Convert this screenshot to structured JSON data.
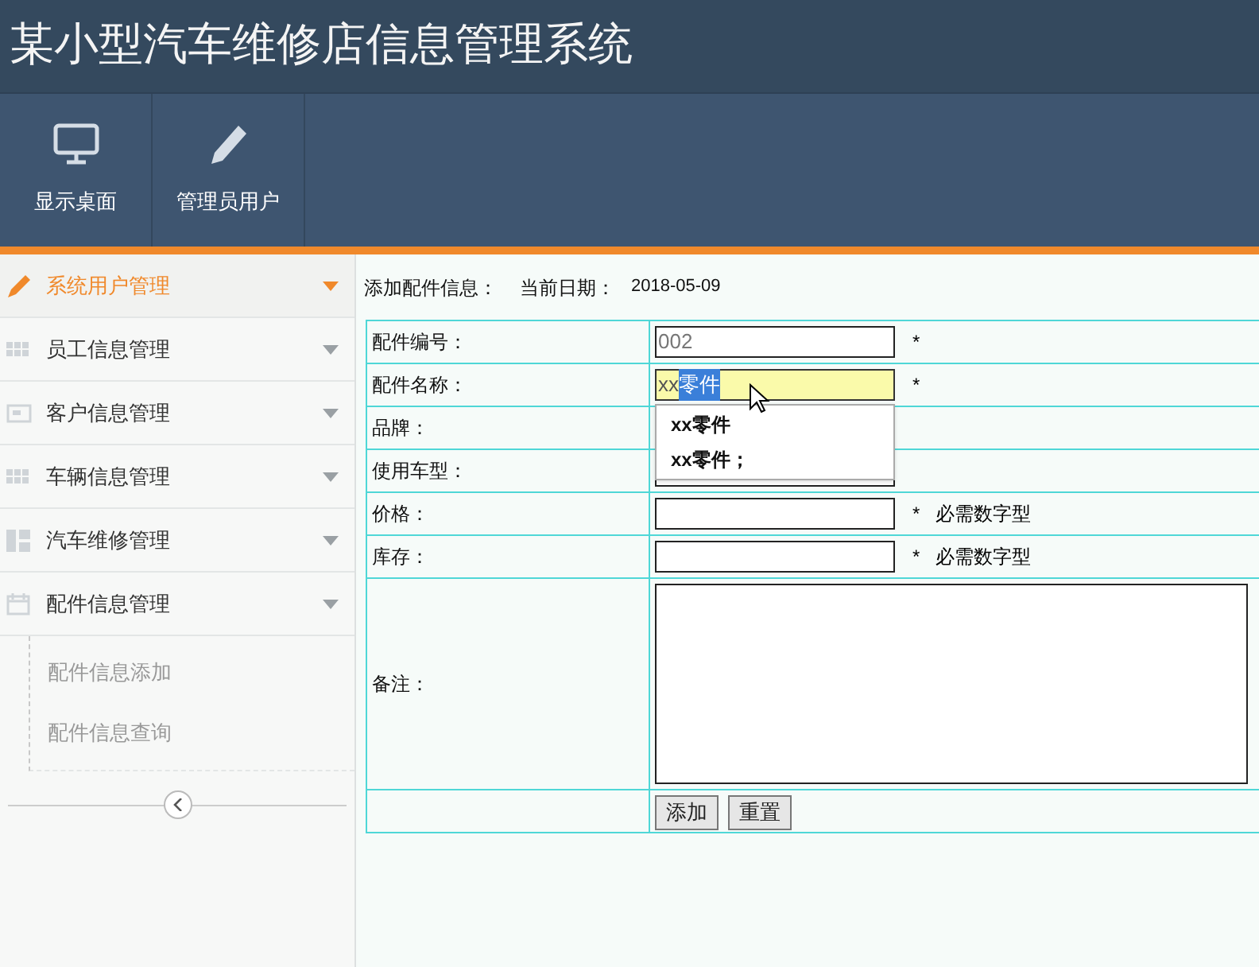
{
  "header": {
    "title": "某小型汽车维修店信息管理系统"
  },
  "toolbar": [
    {
      "label": "显示桌面"
    },
    {
      "label": "管理员用户"
    }
  ],
  "sidebar": {
    "items": [
      {
        "label": "系统用户管理",
        "selected": true
      },
      {
        "label": "员工信息管理",
        "selected": false
      },
      {
        "label": "客户信息管理",
        "selected": false
      },
      {
        "label": "车辆信息管理",
        "selected": false
      },
      {
        "label": "汽车维修管理",
        "selected": false
      },
      {
        "label": "配件信息管理",
        "selected": false,
        "children": [
          {
            "label": "配件信息添加"
          },
          {
            "label": "配件信息查询"
          }
        ]
      }
    ]
  },
  "page": {
    "heading": "添加配件信息：",
    "date_label": "当前日期：",
    "date": "2018-05-09"
  },
  "form": {
    "rows": [
      {
        "kind": "input",
        "label": "配件编号：",
        "value": "002",
        "required": "*"
      },
      {
        "kind": "input",
        "label": "配件名称：",
        "value": "xx",
        "selection": "零件",
        "focused": true,
        "required": "*"
      },
      {
        "kind": "label",
        "label": "品牌："
      },
      {
        "kind": "input",
        "label": "使用车型："
      },
      {
        "kind": "input",
        "label": "价格：",
        "required": "*",
        "hint": "必需数字型"
      },
      {
        "kind": "input",
        "label": "库存：",
        "required": "*",
        "hint": "必需数字型"
      },
      {
        "kind": "textarea",
        "label": "备注："
      },
      {
        "kind": "buttons",
        "buttons": [
          "添加",
          "重置"
        ]
      }
    ],
    "suggestions": [
      "xx零件",
      "xx零件；"
    ]
  }
}
